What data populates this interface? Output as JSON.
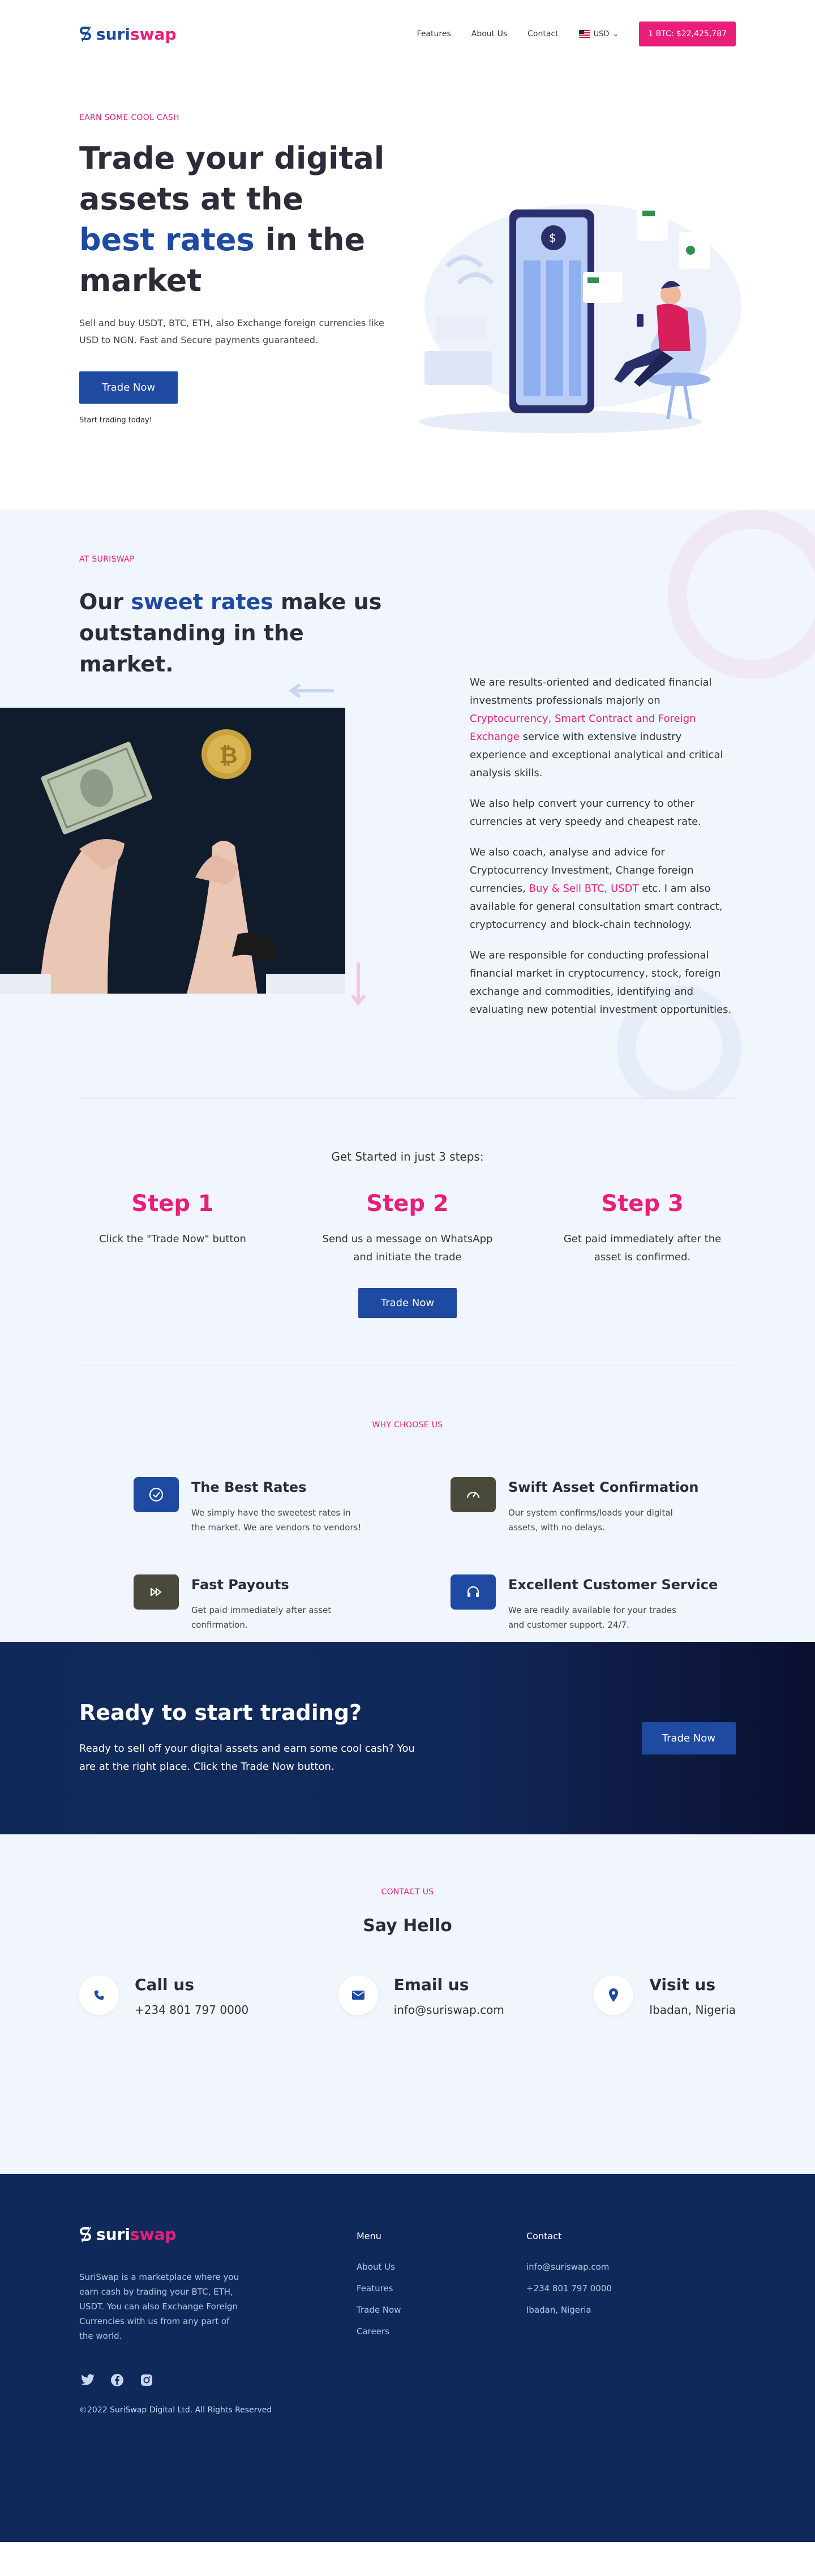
{
  "brand": {
    "name_part1": "suri",
    "name_part2": "swap"
  },
  "nav": {
    "links": [
      "Features",
      "About Us",
      "Contact"
    ],
    "currency": "USD",
    "rate_button": "1 BTC: $22,425,787"
  },
  "hero": {
    "eyebrow": "EARN SOME COOL CASH",
    "title_a": "Trade your digital assets at the ",
    "title_hl": "best rates",
    "title_b": " in the market",
    "subtitle": "Sell and buy USDT, BTC, ETH, also Exchange foreign currencies like USD to NGN. Fast and Secure payments guaranteed.",
    "cta": "Trade Now",
    "note": "Start trading today!"
  },
  "about": {
    "eyebrow": "AT SURISWAP",
    "title_a": "Our ",
    "title_hl": "sweet rates",
    "title_b": " make us outstanding in the market.",
    "p1_a": "We are results-oriented and dedicated financial investments professionals majorly on ",
    "p1_hl": "Cryptocurrency, Smart Contract and Foreign Exchange",
    "p1_b": " service with extensive industry experience and exceptional analytical and critical analysis  skills.",
    "p2": "We also help convert your currency to other currencies at very speedy and cheapest rate.",
    "p3_a": "We also coach, analyse and advice for Cryptocurrency Investment, Change foreign currencies, ",
    "p3_hl": "Buy & Sell BTC, USDT",
    "p3_b": " etc. I am also available for general consultation smart contract, cryptocurrency and block-chain technology.",
    "p4": "We are responsible for conducting professional financial market in cryptocurrency, stock, foreign exchange and commodities, identifying and evaluating new potential investment opportunities."
  },
  "steps": {
    "title": "Get Started in just 3 steps:",
    "items": [
      {
        "heading": "Step 1",
        "text": "Click the \"Trade Now\" button"
      },
      {
        "heading": "Step 2",
        "text": "Send us a message on WhatsApp and initiate the trade"
      },
      {
        "heading": "Step 3",
        "text": "Get paid immediately after the asset is confirmed."
      }
    ],
    "cta": "Trade Now"
  },
  "why": {
    "eyebrow": "WHY CHOOSE US",
    "items": [
      {
        "title": "The Best Rates",
        "text": "We simply have the sweetest rates in the market. We are vendors to vendors!",
        "icon": "check-circle-icon",
        "color": "#1e4aa1"
      },
      {
        "title": "Swift Asset Confirmation",
        "text": "Our system confirms/loads your digital assets, with no delays.",
        "icon": "speedometer-icon",
        "color": "#4a4a3a"
      },
      {
        "title": "Fast Payouts",
        "text": "Get paid immediately after asset confirmation.",
        "icon": "fast-forward-icon",
        "color": "#4a4a3a"
      },
      {
        "title": "Excellent Customer Service",
        "text": "We are readily available for your trades and customer support. 24/7.",
        "icon": "headset-icon",
        "color": "#1e4aa1"
      }
    ]
  },
  "cta": {
    "title": "Ready to start trading?",
    "text": "Ready to sell off your digital assets and earn some cool cash? You are at the right place. Click the Trade Now button.",
    "button": "Trade Now"
  },
  "contact": {
    "eyebrow": "CONTACT US",
    "title": "Say Hello",
    "items": [
      {
        "title": "Call us",
        "value": "+234 801 797 0000",
        "icon": "phone-icon"
      },
      {
        "title": "Email us",
        "value": "info@suriswap.com",
        "icon": "mail-icon"
      },
      {
        "title": "Visit us",
        "value": "Ibadan, Nigeria",
        "icon": "location-pin-icon"
      }
    ]
  },
  "footer": {
    "about": "SuriSwap is a marketplace where you earn cash by trading your BTC, ETH, USDT. You can also Exchange Foreign Currencies with us from any part of the world.",
    "menu_title": "Menu",
    "menu": [
      "About Us",
      "Features",
      "Trade Now",
      "Careers"
    ],
    "contact_title": "Contact",
    "contact": [
      "info@suriswap.com",
      "+234 801 797 0000",
      "Ibadan, Nigeria"
    ],
    "socials": [
      "twitter-icon",
      "facebook-icon",
      "instagram-icon"
    ],
    "copyright": "©2022 SuriSwap Digital Ltd. All Rights Reserved"
  }
}
